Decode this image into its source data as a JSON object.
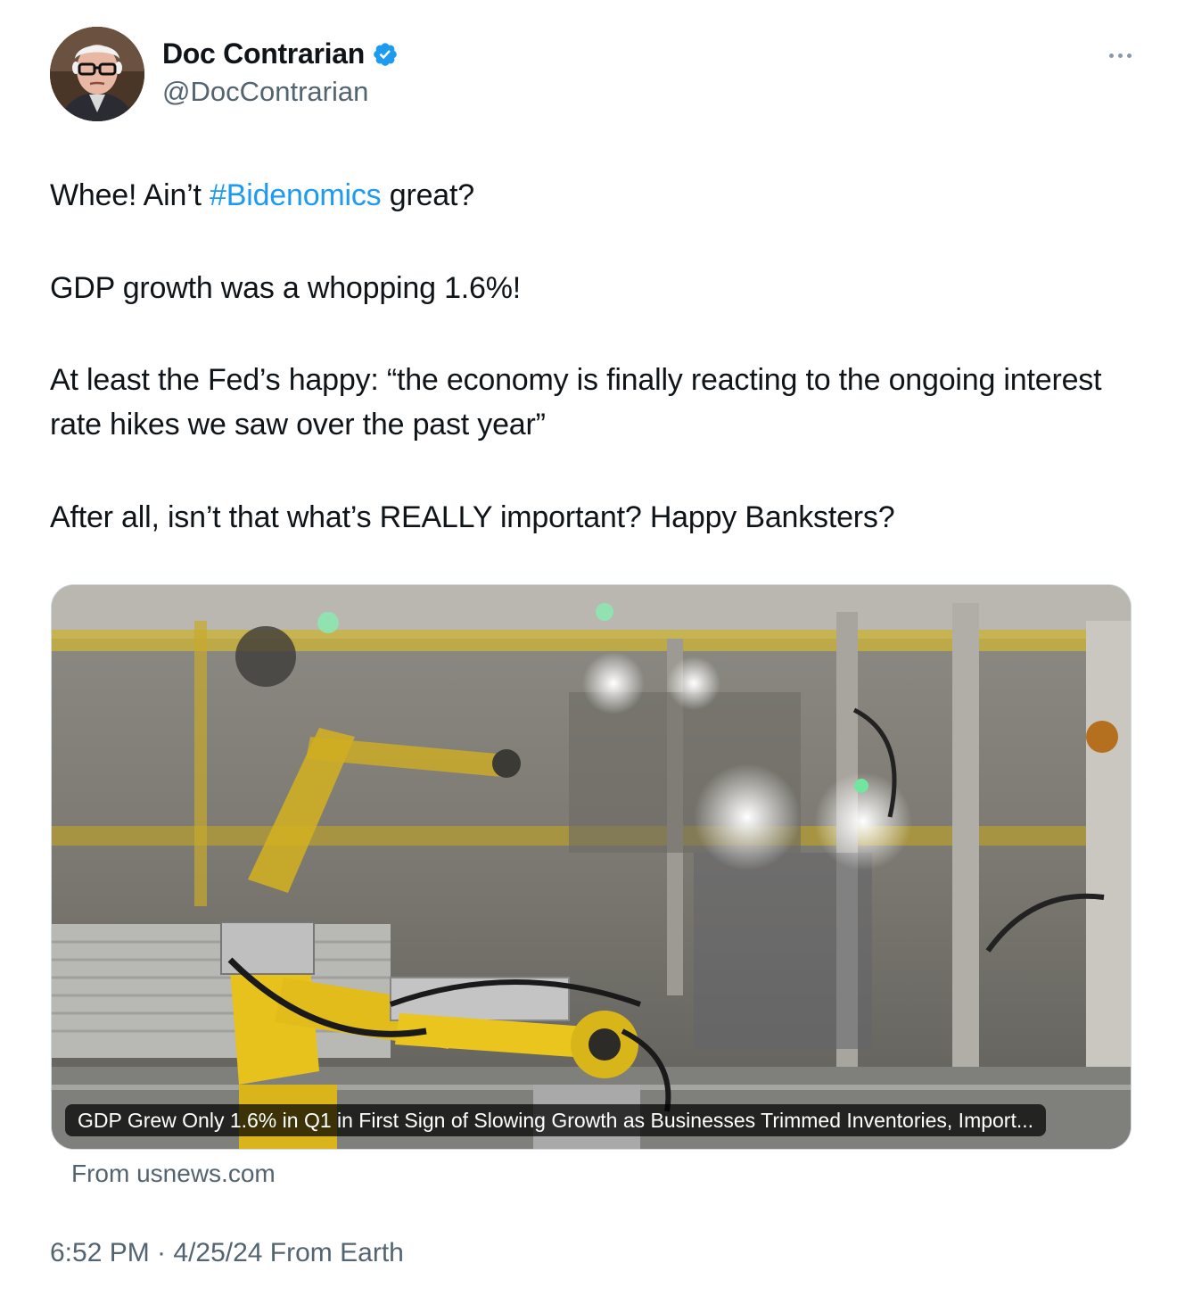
{
  "author": {
    "display_name": "Doc Contrarian",
    "handle": "@DocContrarian",
    "verified": true,
    "avatar_icon": "profile-photo"
  },
  "more_icon": "more-horizontal-icon",
  "tweet": {
    "line1_before": "Whee! Ain’t ",
    "line1_hashtag": "#Bidenomics",
    "line1_after": " great?",
    "line2": "GDP growth was a whopping 1.6%!",
    "line3": "At least the Fed’s happy: “the economy is finally reacting to the ongoing interest rate hikes we saw over the past year”",
    "line4": "After all, isn’t that what’s REALLY important? Happy Banksters?"
  },
  "link_card": {
    "title": "GDP Grew Only 1.6% in Q1 in First Sign of Slowing Growth as Businesses Trimmed Inventories, Import...",
    "source": "From usnews.com"
  },
  "timestamp": "6:52 PM · 4/25/24 From Earth",
  "colors": {
    "link": "#1d9bf0",
    "verified": "#1d9bf0",
    "secondary_text": "#536471",
    "text": "#0f1419"
  }
}
